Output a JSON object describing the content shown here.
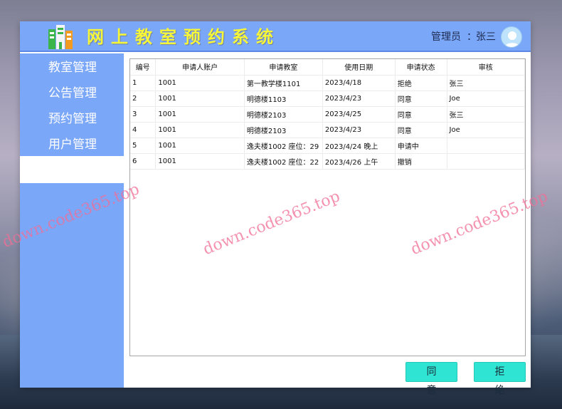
{
  "header": {
    "title": "网上教室预约系统",
    "admin_label": "管理员",
    "admin_separator": "：",
    "admin_name": "张三"
  },
  "sidebar": {
    "items": [
      {
        "label": "教室管理"
      },
      {
        "label": "公告管理"
      },
      {
        "label": "预约管理"
      },
      {
        "label": "用户管理"
      }
    ]
  },
  "table": {
    "columns": [
      "编号",
      "申请人账户",
      "申请教室",
      "使用日期",
      "申请状态",
      "审核"
    ],
    "rows": [
      [
        "1",
        "1001",
        "第一教学楼1101",
        "2023/4/18",
        "拒绝",
        "张三"
      ],
      [
        "2",
        "1001",
        "明德楼1103",
        "2023/4/23",
        "同意",
        "Joe"
      ],
      [
        "3",
        "1001",
        "明德楼2103",
        "2023/4/25",
        "同意",
        "张三"
      ],
      [
        "4",
        "1001",
        "明德楼2103",
        "2023/4/23",
        "同意",
        "Joe"
      ],
      [
        "5",
        "1001",
        "逸夫楼1002 座位：29",
        "2023/4/24 晚上",
        "申请中",
        ""
      ],
      [
        "6",
        "1001",
        "逸夫楼1002 座位：22",
        "2023/4/26 上午",
        "撤销",
        ""
      ]
    ]
  },
  "actions": {
    "approve_label": "同意",
    "reject_label": "拒绝"
  },
  "watermarks": [
    "down.code365.top",
    "down.code365.top",
    "down.code365.top"
  ],
  "colors": {
    "accent": "#7ba7f9",
    "button": "#2fe4d3",
    "title_text": "#f5f53a"
  },
  "icons": {
    "logo": "building-logo-icon",
    "avatar": "user-avatar-icon"
  }
}
